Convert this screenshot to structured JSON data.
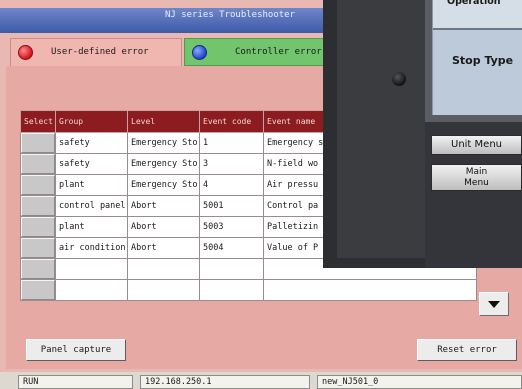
{
  "window": {
    "title": "NJ series Troubleshooter"
  },
  "tabs": [
    {
      "label": "User-defined error",
      "color": "#d4141c"
    },
    {
      "label": "Controller error",
      "color": "#1f45c9"
    }
  ],
  "table": {
    "columns": [
      "Select",
      "Group",
      "Level",
      "Event code",
      "Event name"
    ],
    "rows": [
      {
        "group": "safety",
        "level": "Emergency Sto",
        "code": "1",
        "name": "Emergency s"
      },
      {
        "group": "safety",
        "level": "Emergency Sto",
        "code": "3",
        "name": "N-field wo"
      },
      {
        "group": "plant",
        "level": "Emergency Sto",
        "code": "4",
        "name": "Air pressu"
      },
      {
        "group": "control panel",
        "level": "Abort",
        "code": "5001",
        "name": "Control pa"
      },
      {
        "group": "plant",
        "level": "Abort",
        "code": "5003",
        "name": "Palletizin"
      },
      {
        "group": "air condition",
        "level": "Abort",
        "code": "5004",
        "name": "Value of P"
      },
      {
        "group": "",
        "level": "",
        "code": "",
        "name": ""
      },
      {
        "group": "",
        "level": "",
        "code": "",
        "name": ""
      }
    ]
  },
  "buttons": {
    "capture": "Panel capture",
    "reset": "Reset error"
  },
  "statusbar": {
    "mode": "RUN",
    "ip": "192.168.250.1",
    "controller": "new_NJ501_0"
  },
  "device": {
    "operation_label": "Operation",
    "stop_type_label": "Stop Type",
    "unit_menu": "Unit Menu",
    "main_menu_line1": "Main",
    "main_menu_line2": "Menu"
  },
  "colors": {
    "title_bar": "#3e5aa8",
    "header": "#8c1c20",
    "tab_controller": "#72c56d",
    "panel_bg": "#e6a9a4"
  }
}
